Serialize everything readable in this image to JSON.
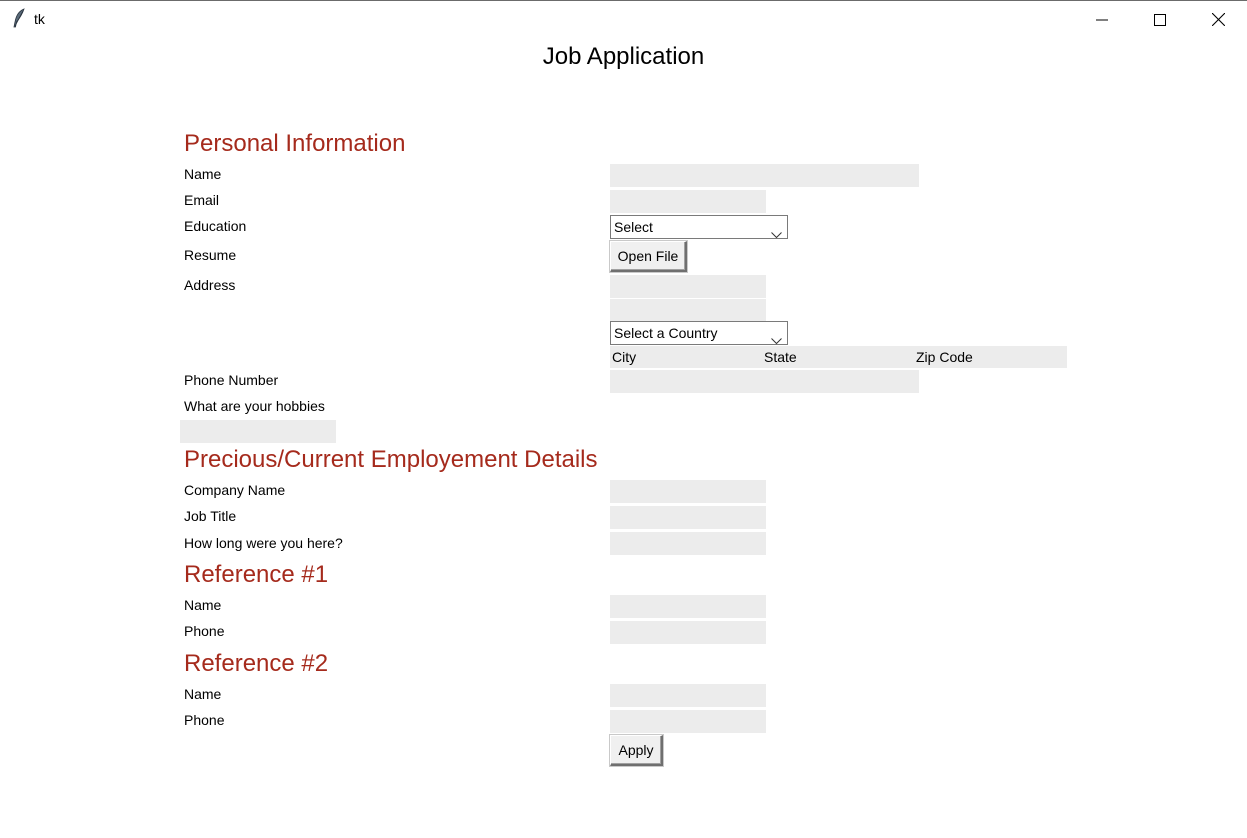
{
  "window": {
    "app_name": "tk"
  },
  "title": "Job Application",
  "personal": {
    "heading": "Personal Information",
    "name_label": "Name",
    "email_label": "Email",
    "education_label": "Education",
    "education_selected": "Select",
    "resume_label": "Resume",
    "open_file_label": "Open File",
    "address_label": "Address",
    "country_selected": "Select a Country",
    "city_label": "City",
    "state_label": "State",
    "zip_label": "Zip Code",
    "phone_label": "Phone Number",
    "hobbies_label": "What are your hobbies"
  },
  "employment": {
    "heading": "Precious/Current Employement Details",
    "company_label": "Company Name",
    "job_title_label": "Job Title",
    "duration_label": "How long were you here?"
  },
  "ref1": {
    "heading": "Reference #1",
    "name_label": "Name",
    "phone_label": "Phone"
  },
  "ref2": {
    "heading": "Reference #2",
    "name_label": "Name",
    "phone_label": "Phone"
  },
  "apply_label": "Apply",
  "colors": {
    "section_heading": "#a52a1c",
    "entry_bg": "#ececec"
  }
}
